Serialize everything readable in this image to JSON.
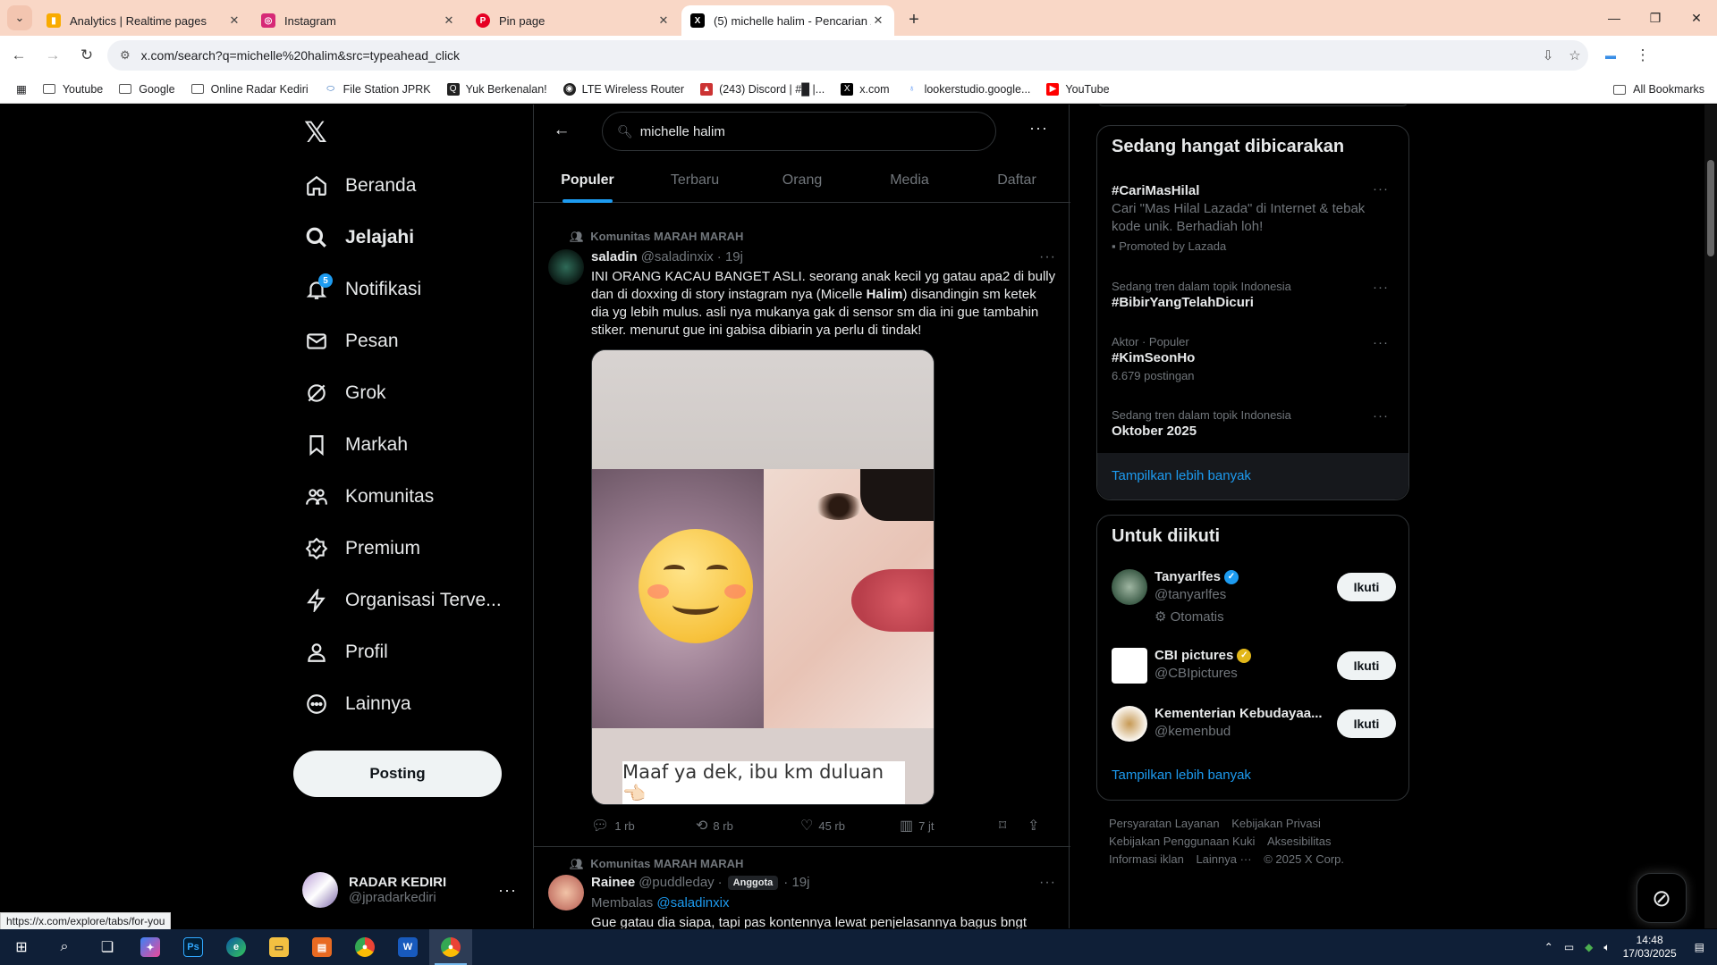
{
  "browser": {
    "tabs": [
      {
        "title": "Analytics | Realtime pages",
        "favicon": "analytics-icon",
        "color": "#f9ab00"
      },
      {
        "title": "Instagram",
        "favicon": "instagram-icon",
        "color": "#d62976"
      },
      {
        "title": "Pin page",
        "favicon": "pinterest-icon",
        "color": "#e60023"
      },
      {
        "title": "(5) michelle halim - Pencarian /",
        "favicon": "x-icon",
        "color": "#000000"
      }
    ],
    "url": "x.com/search?q=michelle%20halim&src=typeahead_click",
    "bookmarks": [
      "Youtube",
      "Google",
      "Online Radar Kediri",
      "File Station JPRK",
      "Yuk Berkenalan!",
      "LTE Wireless Router",
      "(243) Discord | #█ |...",
      "x.com",
      "lookerstudio.google...",
      "YouTube"
    ],
    "all_bookmarks": "All Bookmarks",
    "status_url": "https://x.com/explore/tabs/for-you"
  },
  "nav": {
    "items": [
      "Beranda",
      "Jelajahi",
      "Notifikasi",
      "Pesan",
      "Grok",
      "Markah",
      "Komunitas",
      "Premium",
      "Organisasi Terve...",
      "Profil",
      "Lainnya"
    ],
    "notif_count": "5",
    "post_label": "Posting",
    "account": {
      "name": "RADAR KEDIRI",
      "handle": "@jpradarkediri"
    }
  },
  "search": {
    "query": "michelle halim",
    "tabs": [
      "Populer",
      "Terbaru",
      "Orang",
      "Media",
      "Daftar"
    ]
  },
  "tweets": [
    {
      "community": "Komunitas MARAH MARAH",
      "name": "saladin",
      "handle": "@saladinxix",
      "time": "· 19j",
      "text_a": "INI ORANG KACAU BANGET ASLI. seorang anak kecil yg gatau apa2 di bully dan di doxxing di story instagram nya (Micelle ",
      "text_bold": "Halim",
      "text_b": ") disandingin sm ketek dia yg lebih mulus. asli nya mukanya gak di sensor sm dia ini gue tambahin stiker. menurut gue ini gabisa dibiarin ya perlu di tindak!",
      "image_caption": "Maaf ya dek, ibu km duluan 👈🏻",
      "replies": "1 rb",
      "reposts": "8 rb",
      "likes": "45 rb",
      "views": "7 jt"
    },
    {
      "community": "Komunitas MARAH MARAH",
      "name": "Rainee",
      "handle": "@puddleday",
      "badge": "Anggota",
      "time": "· 19j",
      "reply_prefix": "Membalas",
      "reply_to": "@saladinxix",
      "text": "Gue gatau dia siapa, tapi pas kontennya lewat penjelasannya bagus bngt"
    }
  ],
  "trends": {
    "title": "Sedang hangat dibicarakan",
    "items": [
      {
        "meta": "",
        "title": "#CariMasHilal",
        "desc": "Cari \"Mas Hilal Lazada\" di Internet & tebak kode unik. Berhadiah loh!",
        "promo": "Promoted by Lazada"
      },
      {
        "meta": "Sedang tren dalam topik Indonesia",
        "title": "#BibirYangTelahDicuri"
      },
      {
        "meta": "Aktor · Populer",
        "title": "#KimSeonHo",
        "desc": "6.679 postingan"
      },
      {
        "meta": "Sedang tren dalam topik Indonesia",
        "title": "Oktober 2025"
      }
    ],
    "show_more": "Tampilkan lebih banyak"
  },
  "who_to_follow": {
    "title": "Untuk diikuti",
    "items": [
      {
        "name": "Tanyarlfes",
        "handle": "@tanyarlfes",
        "extra": "Otomatis",
        "verified_color": "#1d9bf0"
      },
      {
        "name": "CBI pictures",
        "handle": "@CBIpictures",
        "verified_color": "#e2b719"
      },
      {
        "name": "Kementerian Kebudayaa...",
        "handle": "@kemenbud"
      }
    ],
    "follow_label": "Ikuti",
    "show_more": "Tampilkan lebih banyak"
  },
  "footer": [
    "Persyaratan Layanan",
    "Kebijakan Privasi",
    "Kebijakan Penggunaan Kuki",
    "Aksesibilitas",
    "Informasi iklan",
    "Lainnya ···",
    "© 2025 X Corp."
  ],
  "taskbar": {
    "time": "14:48",
    "date": "17/03/2025"
  }
}
